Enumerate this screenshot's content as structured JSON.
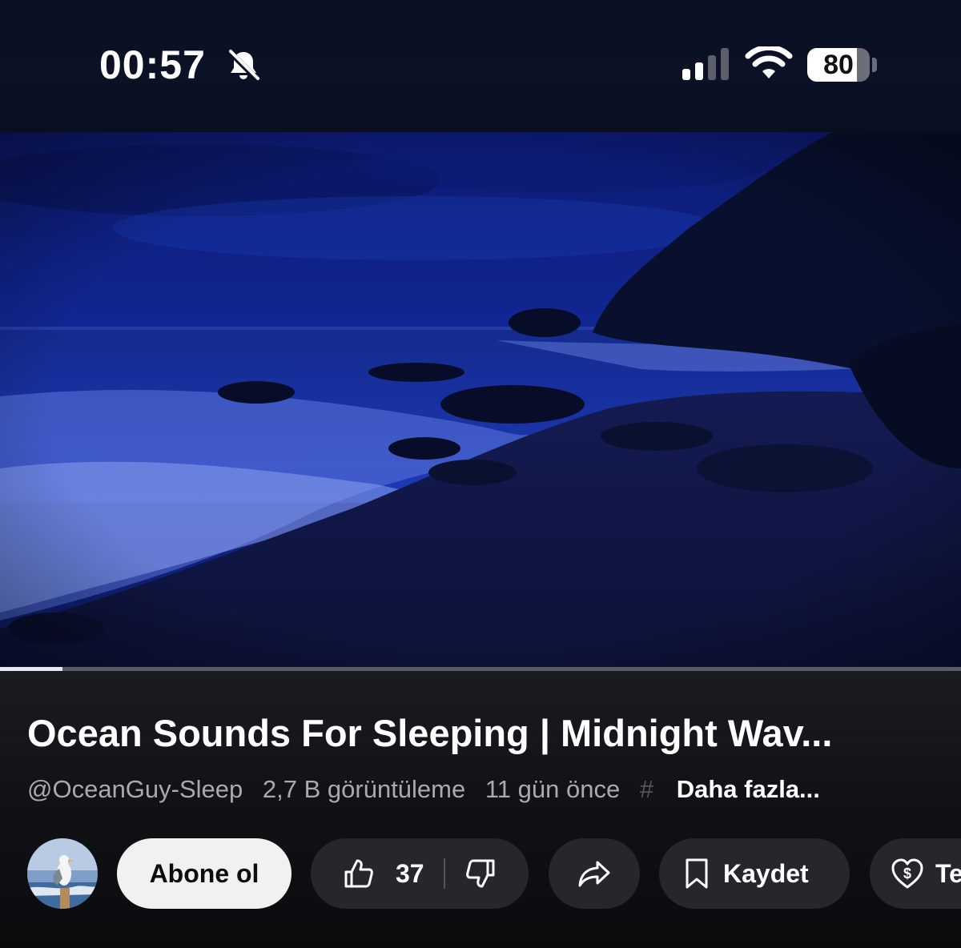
{
  "status_bar": {
    "time": "00:57",
    "battery_percent": 80
  },
  "video": {
    "progress": 0.065
  },
  "info": {
    "title": "Ocean Sounds For Sleeping | Midnight Wav...",
    "channel_handle": "@OceanGuy-Sleep",
    "views": "2,7 B görüntüleme",
    "age": "11 gün önce",
    "hash": "#",
    "more": "Daha fazla..."
  },
  "actions": {
    "subscribe_label": "Abone ol",
    "like_count": "37",
    "save_label": "Kaydet",
    "thanks_label": "Te"
  },
  "colors": {
    "background": "#0b0b0d",
    "pill": "#26272d",
    "subscribe_bg": "#f1f1f1"
  },
  "icons": [
    "bell-slash-icon",
    "cellular-signal-icon",
    "wifi-icon",
    "battery-icon",
    "thumbs-up-icon",
    "thumbs-down-icon",
    "share-icon",
    "bookmark-icon",
    "heart-dollar-icon"
  ]
}
